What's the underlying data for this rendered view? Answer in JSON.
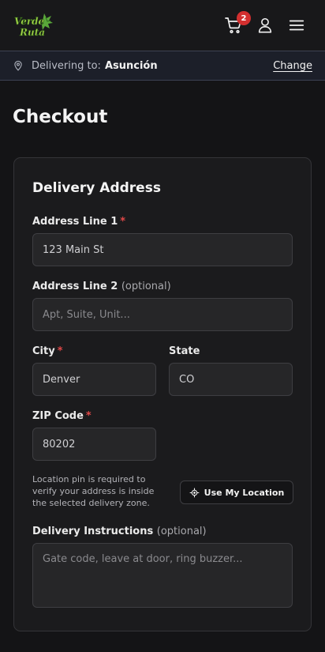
{
  "header": {
    "logo_text": "Verde Ruta",
    "cart_count": "2"
  },
  "delivery_bar": {
    "label": "Delivering to:",
    "city": "Asunción",
    "change_link": "Change"
  },
  "page_title": "Checkout",
  "delivery_address": {
    "title": "Delivery Address",
    "address_line1": {
      "label": "Address Line 1",
      "required": "*",
      "value": "123 Main St"
    },
    "address_line2": {
      "label": "Address Line 2",
      "optional": "(optional)",
      "placeholder": "Apt, Suite, Unit..."
    },
    "city": {
      "label": "City",
      "required": "*",
      "value": "Denver"
    },
    "state": {
      "label": "State",
      "value": "CO"
    },
    "zip": {
      "label": "ZIP Code",
      "required": "*",
      "value": "80202"
    },
    "location_hint": "Location pin is required to verify your address is inside the selected delivery zone.",
    "use_location_button": "Use My Location",
    "instructions": {
      "label": "Delivery Instructions",
      "optional": "(optional)",
      "placeholder": "Gate code, leave at door, ring buzzer..."
    }
  },
  "colors": {
    "background": "#141416",
    "card": "#1b1b1d",
    "required_star": "#e04848",
    "badge": "#d32f2f",
    "logo_green": "#7cc242"
  }
}
